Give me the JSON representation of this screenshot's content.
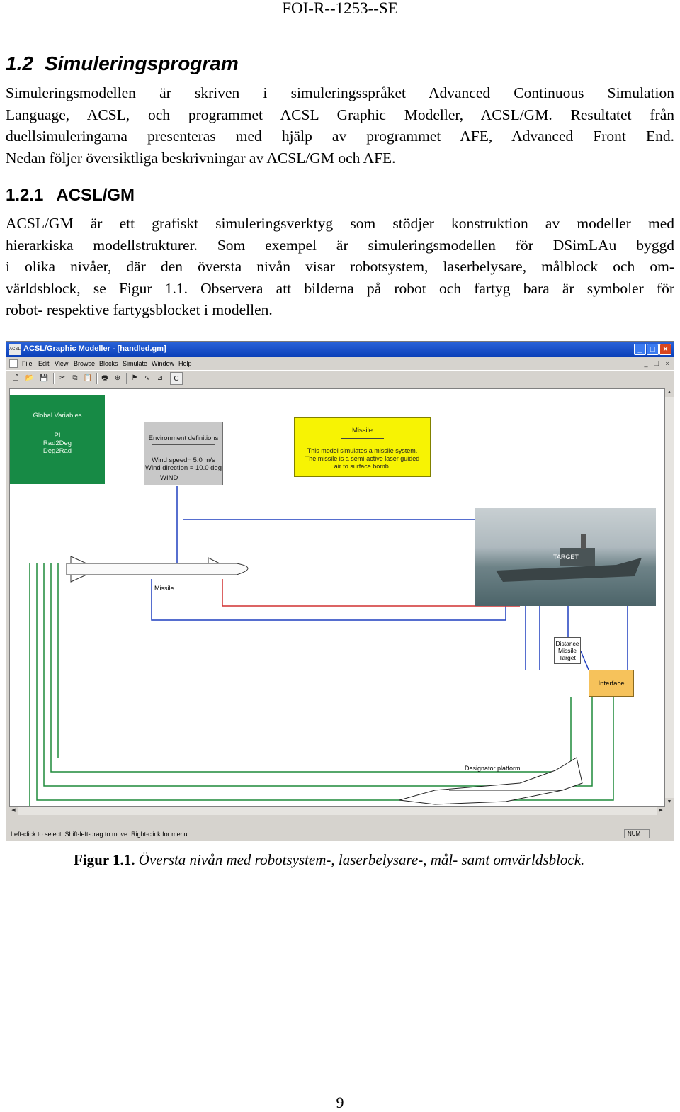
{
  "header": "FOI-R--1253--SE",
  "section": {
    "number": "1.2",
    "title": "Simuleringsprogram"
  },
  "para1": [
    "Simuleringsmodellen är skriven i simuleringsspråket Advanced Continuous Simulation",
    "Language, ACSL, och programmet ACSL Graphic Modeller, ACSL/GM. Resultatet från",
    "duellsimuleringarna presenteras med hjälp av programmet AFE, Advanced Front End.",
    "Nedan följer översiktliga beskrivningar av ACSL/GM och AFE."
  ],
  "subsection": {
    "number": "1.2.1",
    "title": "ACSL/GM"
  },
  "para2": [
    "ACSL/GM är ett grafiskt simuleringsverktyg som stödjer konstruktion av modeller med",
    "hierarkiska modellstrukturer. Som exempel är simuleringsmodellen för DSimLAu byggd",
    "i olika nivåer, där den översta nivån visar robotsystem, laserbelysare, målblock och om-",
    "världsblock, se Figur 1.1. Observera att bilderna på robot och fartyg bara är symboler för",
    "robot- respektive fartygsblocket i modellen."
  ],
  "window": {
    "app_icon_text": "ACSL",
    "title": "ACSL/Graphic Modeller - [handled.gm]",
    "menu": [
      "File",
      "Edit",
      "View",
      "Browse",
      "Blocks",
      "Simulate",
      "Window",
      "Help"
    ],
    "toolbar_c": "C",
    "status": "Left-click to select. Shift-left-drag to move. Right-click for menu.",
    "num_indicator": "NUM"
  },
  "blocks": {
    "global_vars": {
      "title": "Global Variables",
      "items": [
        "PI",
        "Rad2Deg",
        "Deg2Rad"
      ]
    },
    "env": {
      "title": "Environment definitions",
      "lines": [
        "Wind speed= 5.0 m/s",
        "Wind direction = 10.0 deg"
      ],
      "wind": "WIND"
    },
    "missile_desc": {
      "title": "Missile",
      "lines": [
        "This model simulates a missile system.",
        "The missile is a semi-active laser guided",
        "air to surface bomb."
      ]
    },
    "missile_label": "Missile",
    "target_label": "TARGET",
    "distance": [
      "Distance",
      "Missile",
      "Target"
    ],
    "interface": "Interface",
    "designator": "Designator platform"
  },
  "caption": {
    "label": "Figur 1.1.",
    "text": "Översta nivån med robotsystem-, laserbelysare-, mål- samt omvärldsblock."
  },
  "page_number": "9"
}
